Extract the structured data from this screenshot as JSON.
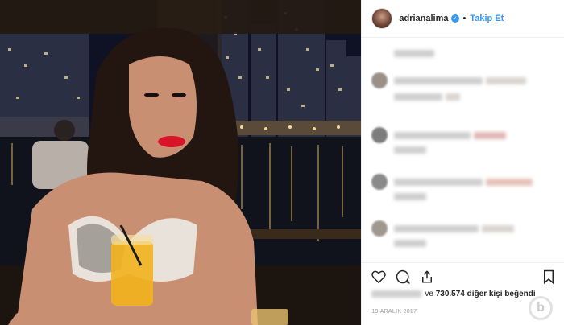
{
  "post": {
    "username": "adrianalima",
    "verified_mark": "✓",
    "separator": "•",
    "follow_label": "Takip Et",
    "likes_prefix": "ve",
    "likes_count": "730.574",
    "likes_suffix": "diğer kişi beğendi",
    "date": "19 ARALIK 2017"
  },
  "icons": {
    "like": "heart-icon",
    "comment": "comment-icon",
    "share": "share-icon",
    "save": "bookmark-icon"
  },
  "colors": {
    "accent": "#3897f0",
    "text": "#262626",
    "muted": "#999999",
    "border": "#efefef",
    "lip": "#d8142a",
    "drink": "#f3b21d"
  }
}
